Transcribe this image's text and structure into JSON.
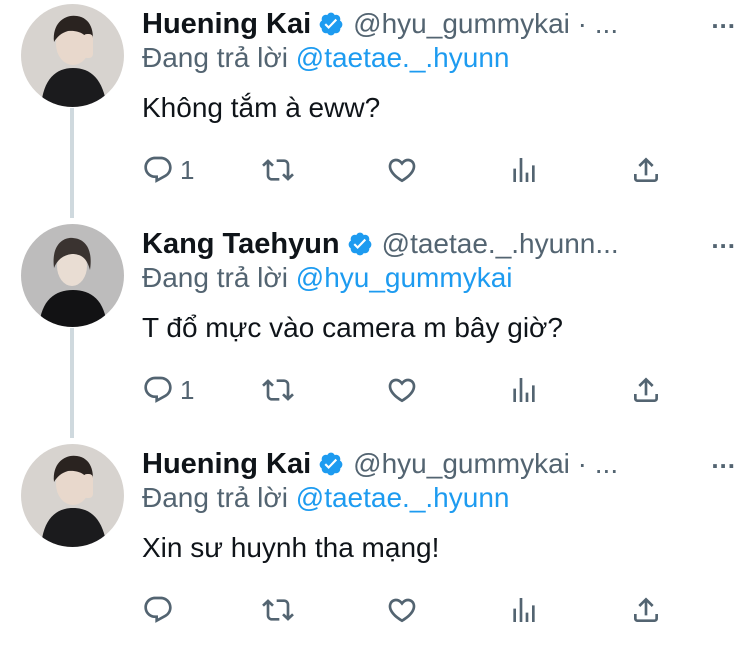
{
  "reply_prefix": "Đang trả lời",
  "more_label": "...",
  "tweets": [
    {
      "name": "Huening Kai",
      "handle": "@hyu_gummykai · ...",
      "reply_to": "@taetae._.hyunn",
      "text": "Không tắm à eww?",
      "reply_count": "1",
      "retweet_count": "",
      "like_count": ""
    },
    {
      "name": "Kang Taehyun",
      "handle": "@taetae._.hyunn...",
      "reply_to": "@hyu_gummykai",
      "text": "T đổ mực vào camera m bây giờ?",
      "reply_count": "1",
      "retweet_count": "",
      "like_count": ""
    },
    {
      "name": "Huening Kai",
      "handle": "@hyu_gummykai · ...",
      "reply_to": "@taetae._.hyunn",
      "text": "Xin sư huynh tha mạng!",
      "reply_count": "",
      "retweet_count": "",
      "like_count": ""
    }
  ],
  "colors": {
    "accent": "#1d9bf0",
    "secondary_text": "#536471",
    "thread_line": "#cfd9de"
  },
  "icons": [
    "verified-badge-icon",
    "reply-icon",
    "retweet-icon",
    "like-icon",
    "analytics-icon",
    "share-icon",
    "more-icon"
  ]
}
